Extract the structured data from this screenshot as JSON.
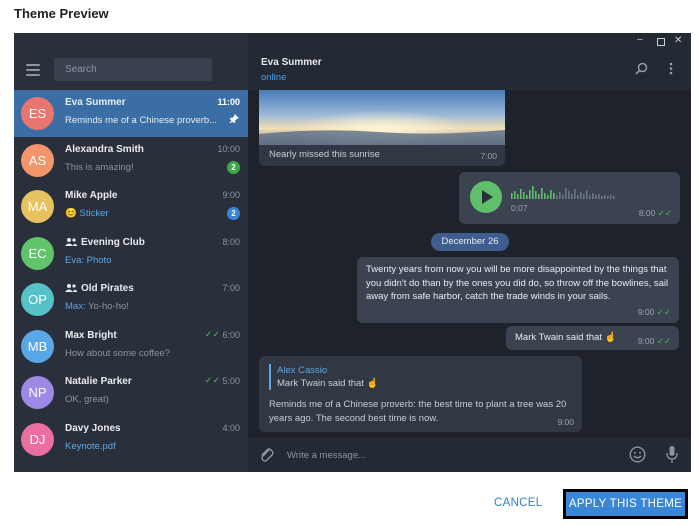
{
  "dialog": {
    "title": "Theme Preview"
  },
  "search": {
    "placeholder": "Search"
  },
  "chats": [
    {
      "initials": "ES",
      "color": "#e8766e",
      "name": "Eva Summer",
      "time": "11:00",
      "message": "Reminds me of a Chinese proverb...",
      "pinned": true
    },
    {
      "initials": "AS",
      "color": "#f2956a",
      "name": "Alexandra Smith",
      "time": "10:00",
      "message": "This is amazing!",
      "badge": "2",
      "badge_color": "green"
    },
    {
      "initials": "MA",
      "color": "#e6c260",
      "name": "Mike Apple",
      "time": "9:00",
      "message_emoji": "😊",
      "message": "Sticker",
      "badge": "2",
      "badge_color": "blue"
    },
    {
      "initials": "EC",
      "color": "#5fc46a",
      "name": "Evening Club",
      "group": true,
      "time": "8:00",
      "prefix": "Eva: ",
      "message": "Photo"
    },
    {
      "initials": "OP",
      "color": "#55c2c7",
      "name": "Old Pirates",
      "group": true,
      "time": "7:00",
      "prefix": "Max: ",
      "message": "Yo-ho-ho!"
    },
    {
      "initials": "MB",
      "color": "#5aa7e6",
      "name": "Max Bright",
      "time": "6:00",
      "message": "How about some coffee?",
      "read": true
    },
    {
      "initials": "NP",
      "color": "#9d89e6",
      "name": "Natalie Parker",
      "time": "5:00",
      "message": "OK, great)",
      "read": true
    },
    {
      "initials": "DJ",
      "color": "#ea6fa0",
      "name": "Davy Jones",
      "time": "4:00",
      "message": "Keynote.pdf",
      "link": true
    }
  ],
  "peer": {
    "name": "Eva Summer",
    "status": "online"
  },
  "messages": {
    "photo_caption": "Nearly missed this sunrise",
    "photo_time": "7:00",
    "voice_duration": "0:07",
    "voice_time": "8:00",
    "date_label": "December 26",
    "quote_text": "Twenty years from now you will be more disappointed by the things that you didn't do than by the ones you did do, so throw off the bowlines, sail away from safe harbor, catch the trade winds in your sails.",
    "quote_time": "9:00",
    "short_text": "Mark Twain said that ☝️",
    "short_time": "9:00",
    "reply_author": "Alex Cassio",
    "reply_quote": "Mark Twain said that ☝️",
    "reply_text": "Reminds me of a Chinese proverb: the best time to plant a tree was 20 years ago. The second best time is now.",
    "reply_time": "9:00"
  },
  "composer": {
    "placeholder": "Write a message..."
  },
  "buttons": {
    "cancel": "CANCEL",
    "apply": "APPLY THIS THEME"
  },
  "colors": {
    "accent": "#3a86d6",
    "sidebar_active": "#3a6ea5",
    "online": "#4a9fe6",
    "read_check": "#4fbf56",
    "voice_play": "#5fbf6a"
  }
}
